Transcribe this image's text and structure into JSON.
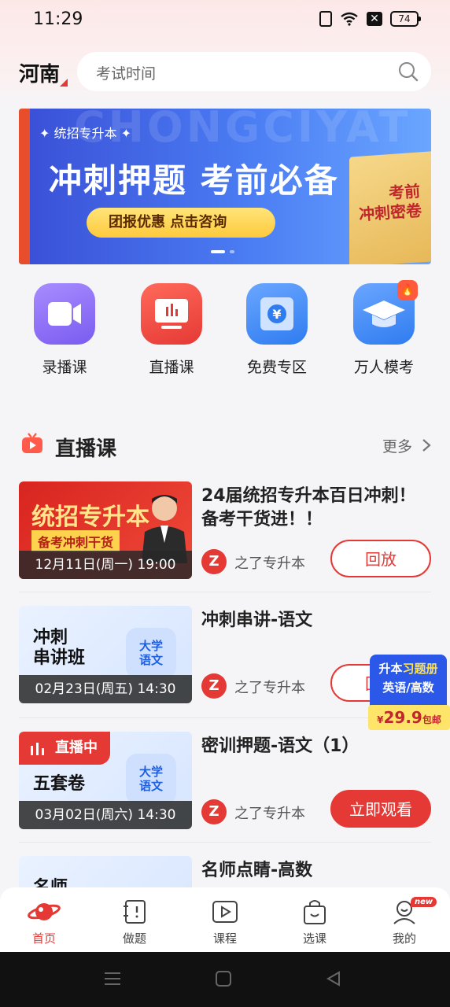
{
  "status": {
    "time": "11:29",
    "battery": "74"
  },
  "header": {
    "city": "河南",
    "search_placeholder": "考试时间"
  },
  "banner": {
    "bg_word": "CHONGCIYAT",
    "tag": "✦ 统招专升本 ✦",
    "title": "冲刺押题 考前必备",
    "button": "团报优惠 点击咨询",
    "book_line1": "考前",
    "book_line2": "冲刺密卷"
  },
  "quick": [
    {
      "label": "录播课",
      "icon": "video-camera-icon",
      "color": "#8b6ff0"
    },
    {
      "label": "直播课",
      "icon": "live-board-icon",
      "color": "#f0473e"
    },
    {
      "label": "免费专区",
      "icon": "yen-film-icon",
      "color": "#3d8bff"
    },
    {
      "label": "万人模考",
      "icon": "graduation-cap-icon",
      "color": "#3d8bff",
      "badge": "fire-icon"
    }
  ],
  "section": {
    "title": "直播课",
    "more": "更多"
  },
  "courses": [
    {
      "title": "24届统招专升本百日冲刺！备考干货进！！",
      "time": "12月11日(周一) 19:00",
      "org": "之了专升本",
      "action": "回放",
      "thumb_main": "统招专升本",
      "thumb_sub": "备考冲刺干货"
    },
    {
      "title": "冲刺串讲-语文",
      "time": "02月23日(周五) 14:30",
      "org": "之了专升本",
      "action": "回放",
      "thumb_line1": "冲刺",
      "thumb_line2": "串讲班",
      "thumb_badge1": "大学",
      "thumb_badge2": "语文"
    },
    {
      "title": "密训押题-语文（1）",
      "time": "03月02日(周六) 14:30",
      "org": "之了专升本",
      "action": "立即观看",
      "live": "直播中",
      "thumb_line2": "五套卷",
      "thumb_badge1": "大学",
      "thumb_badge2": "语文"
    },
    {
      "title": "名师点睛-高数",
      "thumb_line1": "名师"
    }
  ],
  "promo": {
    "line1a": "升本",
    "line1b": "习题册",
    "line2": "英语/高数",
    "price_prefix": "¥",
    "price": "29.9",
    "price_suffix": "包邮"
  },
  "tabs": [
    {
      "label": "首页",
      "icon": "planet-icon",
      "active": true
    },
    {
      "label": "做题",
      "icon": "notebook-icon"
    },
    {
      "label": "课程",
      "icon": "play-icon"
    },
    {
      "label": "选课",
      "icon": "shopping-bag-icon"
    },
    {
      "label": "我的",
      "icon": "user-icon",
      "badge": "new"
    }
  ],
  "colors": {
    "accent": "#e53935",
    "blue": "#2b58e8"
  }
}
